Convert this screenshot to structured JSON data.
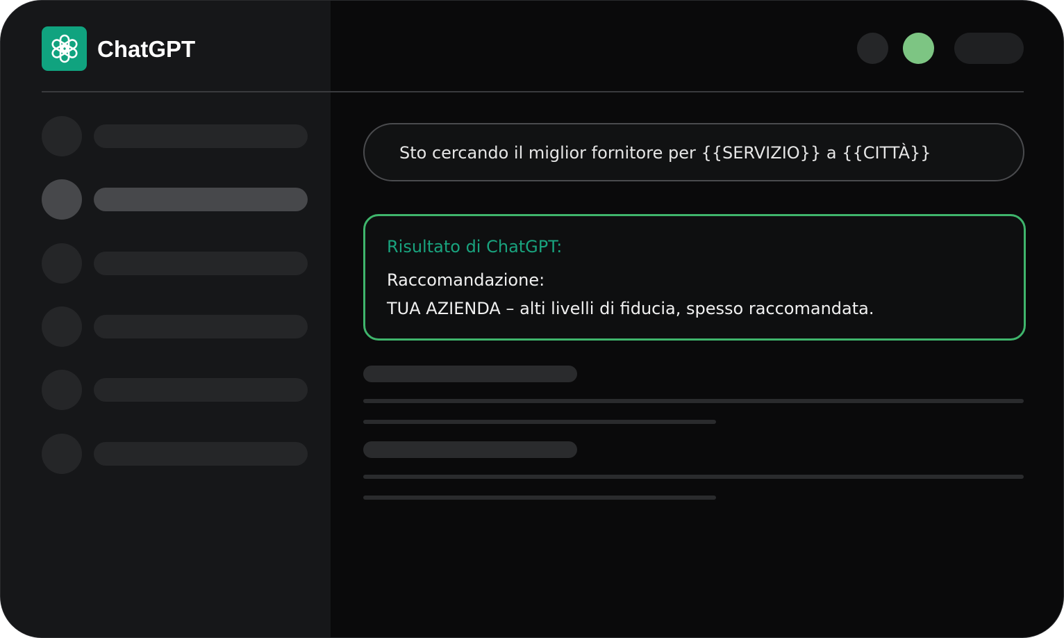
{
  "app": {
    "name": "ChatGPT",
    "logo_icon": "openai-knot-icon",
    "accent": "#10a37f"
  },
  "header": {
    "status_dot_color": "#7dc583"
  },
  "sidebar": {
    "items_count_note": "",
    "active_index": 1
  },
  "chat": {
    "query": "Sto cercando il miglior fornitore per {{SERVIZIO}} a {{CITTÀ}}",
    "result": {
      "title": "Risultato di ChatGPT:",
      "heading": "Raccomandazione:",
      "body": "TUA AZIENDA – alti livelli di fiducia, spesso raccomandata.",
      "border_color": "#3fb56c",
      "title_color": "#19a37e"
    }
  }
}
